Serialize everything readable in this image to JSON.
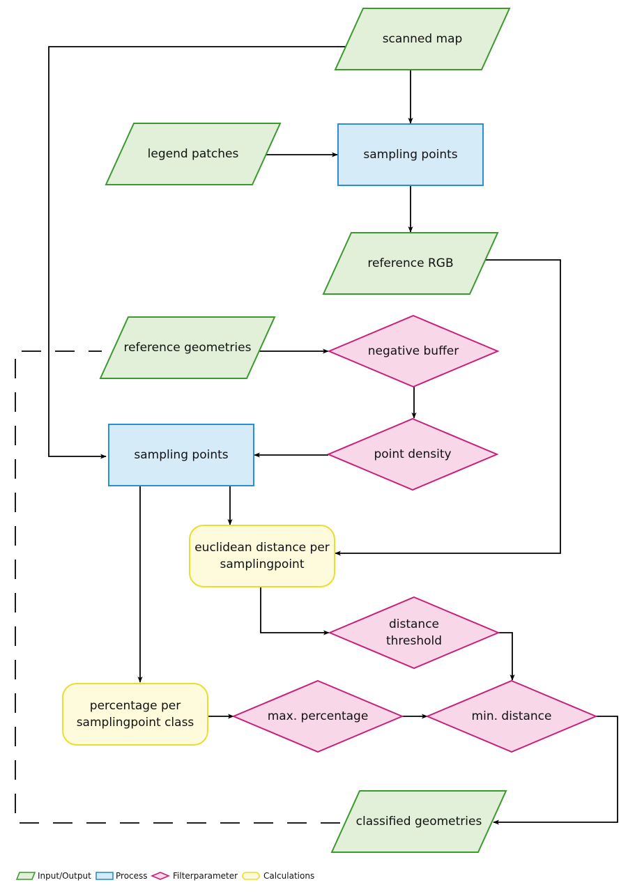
{
  "diagram": {
    "type": "flowchart",
    "colors": {
      "io_fill": "#e2efd9",
      "io_stroke": "#3a9a2e",
      "process_fill": "#d6ebf8",
      "process_stroke": "#2a8ed6",
      "filter_fill": "#f8d7e8",
      "filter_stroke": "#c8207a",
      "calc_fill": "#fdfbdc",
      "calc_stroke": "#e8de30",
      "line": "#000000"
    },
    "nodes": [
      {
        "id": "scanned_map",
        "kind": "io",
        "lines": [
          "scanned map"
        ]
      },
      {
        "id": "legend_patches",
        "kind": "io",
        "lines": [
          "legend patches"
        ]
      },
      {
        "id": "sampling_points_1",
        "kind": "process",
        "lines": [
          "sampling points"
        ]
      },
      {
        "id": "reference_rgb",
        "kind": "io",
        "lines": [
          "reference RGB"
        ]
      },
      {
        "id": "reference_geometries",
        "kind": "io",
        "lines": [
          "reference geometries"
        ]
      },
      {
        "id": "negative_buffer",
        "kind": "filter",
        "lines": [
          "negative buffer"
        ]
      },
      {
        "id": "point_density",
        "kind": "filter",
        "lines": [
          "point density"
        ]
      },
      {
        "id": "sampling_points_2",
        "kind": "process",
        "lines": [
          "sampling points"
        ]
      },
      {
        "id": "euclidean_distance",
        "kind": "calc",
        "lines": [
          "euclidean distance per",
          "samplingpoint"
        ]
      },
      {
        "id": "distance_threshold",
        "kind": "filter",
        "lines": [
          "distance",
          "threshold"
        ]
      },
      {
        "id": "percentage_per_class",
        "kind": "calc",
        "lines": [
          "percentage per",
          "samplingpoint class"
        ]
      },
      {
        "id": "max_percentage",
        "kind": "filter",
        "lines": [
          "max. percentage"
        ]
      },
      {
        "id": "min_distance",
        "kind": "filter",
        "lines": [
          "min. distance"
        ]
      },
      {
        "id": "classified_geometries",
        "kind": "io",
        "lines": [
          "classified geometries"
        ]
      }
    ],
    "edges": [
      {
        "from": "scanned_map",
        "to": "sampling_points_1",
        "style": "solid"
      },
      {
        "from": "legend_patches",
        "to": "sampling_points_1",
        "style": "solid"
      },
      {
        "from": "sampling_points_1",
        "to": "reference_rgb",
        "style": "solid"
      },
      {
        "from": "scanned_map",
        "to": "sampling_points_2",
        "style": "solid"
      },
      {
        "from": "reference_geometries",
        "to": "negative_buffer",
        "style": "solid"
      },
      {
        "from": "negative_buffer",
        "to": "point_density",
        "style": "solid"
      },
      {
        "from": "point_density",
        "to": "sampling_points_2",
        "style": "solid"
      },
      {
        "from": "sampling_points_2",
        "to": "euclidean_distance",
        "style": "solid"
      },
      {
        "from": "reference_rgb",
        "to": "euclidean_distance",
        "style": "solid"
      },
      {
        "from": "euclidean_distance",
        "to": "distance_threshold",
        "style": "solid"
      },
      {
        "from": "sampling_points_2",
        "to": "percentage_per_class",
        "style": "solid"
      },
      {
        "from": "distance_threshold",
        "to": "min_distance",
        "style": "solid"
      },
      {
        "from": "percentage_per_class",
        "to": "max_percentage",
        "style": "solid"
      },
      {
        "from": "max_percentage",
        "to": "min_distance",
        "style": "solid"
      },
      {
        "from": "min_distance",
        "to": "classified_geometries",
        "style": "solid"
      },
      {
        "from": "classified_geometries",
        "to": "reference_geometries",
        "style": "dashed"
      }
    ]
  },
  "legend": [
    {
      "kind": "io",
      "label": "Input/Output"
    },
    {
      "kind": "process",
      "label": "Process"
    },
    {
      "kind": "filter",
      "label": "Filterparameter"
    },
    {
      "kind": "calc",
      "label": "Calculations"
    }
  ]
}
